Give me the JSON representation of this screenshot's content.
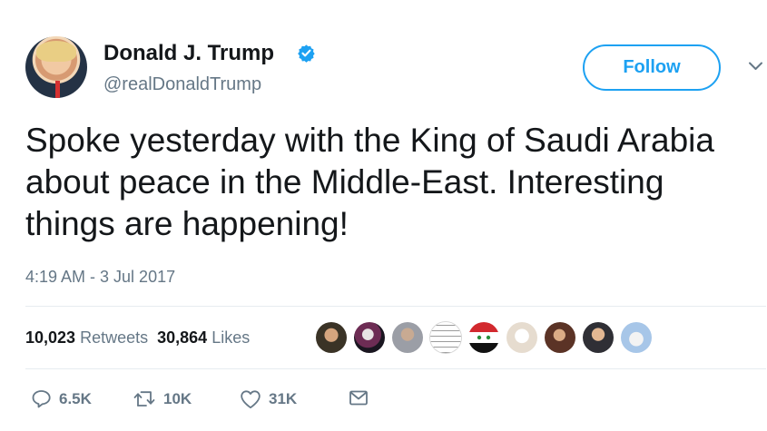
{
  "profile": {
    "name": "Donald J. Trump",
    "handle": "@realDonaldTrump"
  },
  "follow_label": "Follow",
  "tweet": {
    "text": "Spoke yesterday with the King of Saudi Arabia about peace in the Middle-East. Interesting things are happening!",
    "timestamp": "4:19 AM - 3 Jul 2017"
  },
  "stats": {
    "retweets_count": "10,023",
    "retweets_label": "Retweets",
    "likes_count": "30,864",
    "likes_label": "Likes"
  },
  "actions": {
    "reply_count": "6.5K",
    "retweet_count": "10K",
    "like_count": "31K"
  },
  "colors": {
    "accent": "#1da1f2",
    "muted": "#657786",
    "text": "#14171a",
    "divider": "#e6ecf0"
  },
  "icons": [
    "verified-badge-icon",
    "chevron-down-icon",
    "reply-icon",
    "retweet-icon",
    "heart-icon",
    "message-icon"
  ]
}
